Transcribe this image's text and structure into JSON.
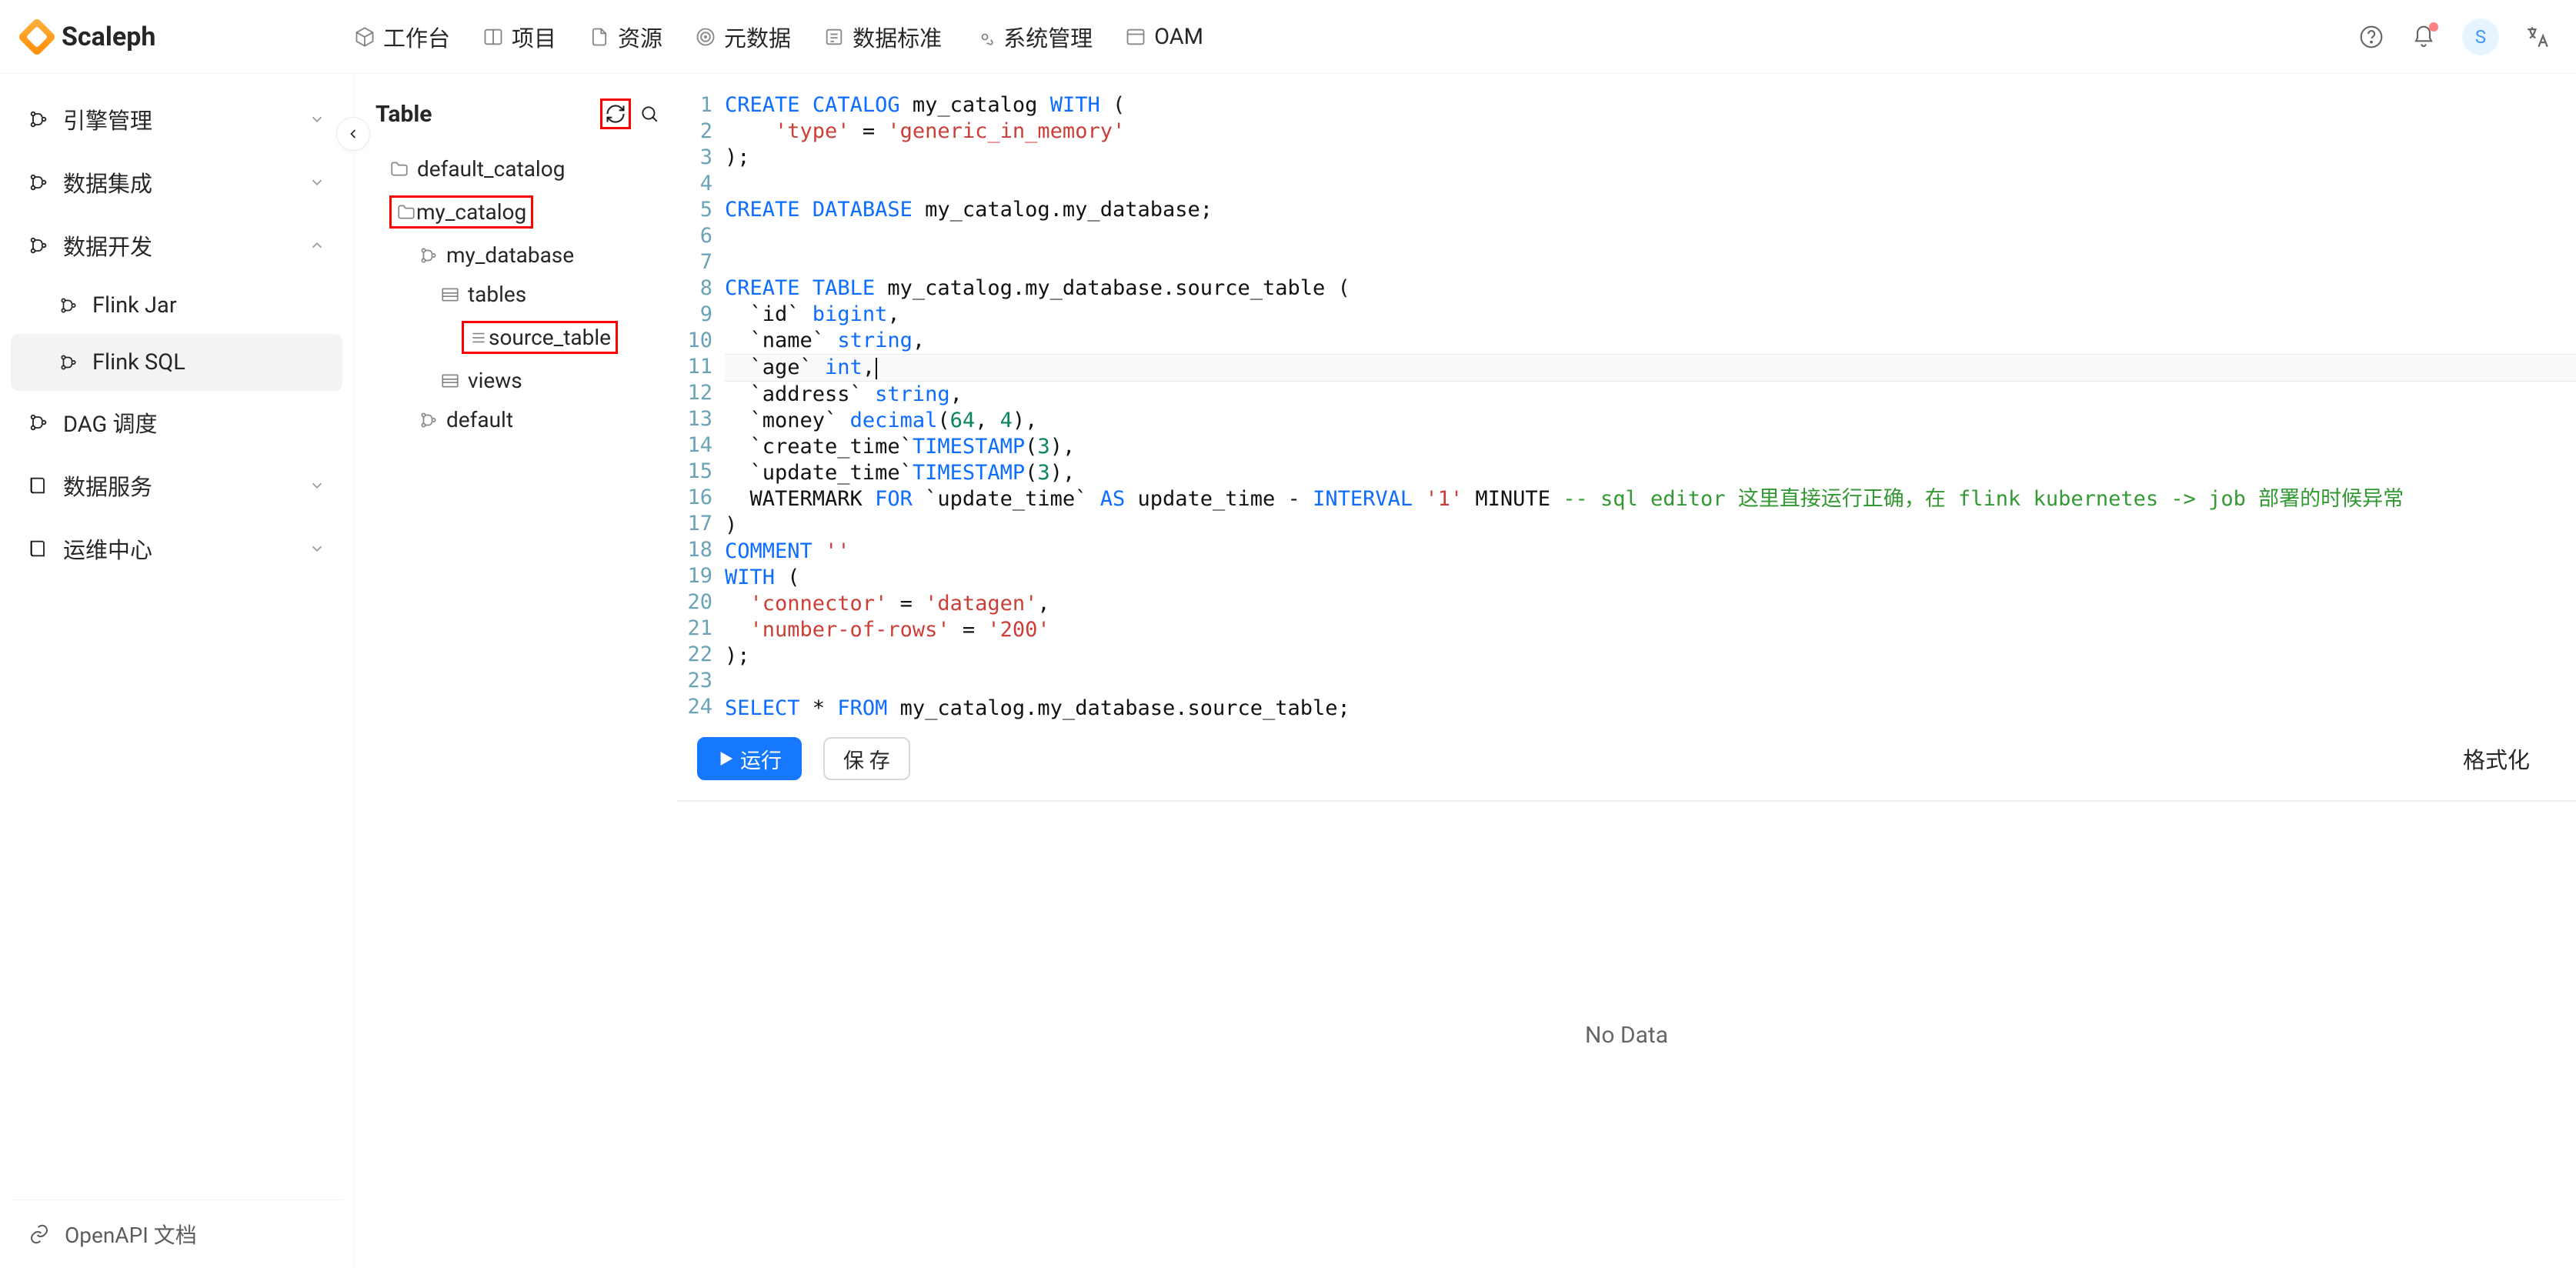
{
  "brand": "Scaleph",
  "topnav": [
    {
      "label": "工作台",
      "icon": "cube"
    },
    {
      "label": "项目",
      "icon": "columns"
    },
    {
      "label": "资源",
      "icon": "file"
    },
    {
      "label": "元数据",
      "icon": "target"
    },
    {
      "label": "数据标准",
      "icon": "list"
    },
    {
      "label": "系统管理",
      "icon": "gear"
    },
    {
      "label": "OAM",
      "icon": "window"
    }
  ],
  "avatar_initial": "S",
  "sidebar": {
    "groups": [
      {
        "label": "引擎管理",
        "expanded": false
      },
      {
        "label": "数据集成",
        "expanded": false
      },
      {
        "label": "数据开发",
        "expanded": true,
        "children": [
          {
            "label": "Flink Jar",
            "active": false
          },
          {
            "label": "Flink SQL",
            "active": true
          }
        ]
      },
      {
        "label": "DAG 调度",
        "leaf": true
      },
      {
        "label": "数据服务",
        "expanded": false
      },
      {
        "label": "运维中心",
        "expanded": false
      }
    ],
    "bottom": "OpenAPI 文档"
  },
  "tablePanel": {
    "title": "Table",
    "tree": [
      {
        "level": 1,
        "icon": "folder",
        "label": "default_catalog"
      },
      {
        "level": 1,
        "icon": "folder",
        "label": "my_catalog",
        "highlight": true
      },
      {
        "level": 2,
        "icon": "branch",
        "label": "my_database"
      },
      {
        "level": 3,
        "icon": "table",
        "label": "tables"
      },
      {
        "level": 4,
        "icon": "rows",
        "label": "source_table",
        "highlight": true
      },
      {
        "level": 3,
        "icon": "table",
        "label": "views"
      },
      {
        "level": 2,
        "icon": "branch",
        "label": "default"
      }
    ]
  },
  "editor": {
    "current_line": 11,
    "lines": [
      [
        {
          "kw": "CREATE"
        },
        {
          "t": " "
        },
        {
          "kw": "CATALOG"
        },
        {
          "t": " my_catalog "
        },
        {
          "kw": "WITH"
        },
        {
          "t": " "
        },
        {
          "ident": "("
        }
      ],
      [
        {
          "t": "    "
        },
        {
          "str": "'type'"
        },
        {
          "t": " = "
        },
        {
          "str": "'generic_in_memory'"
        }
      ],
      [
        {
          "t": ");"
        }
      ],
      [
        {
          "t": ""
        }
      ],
      [
        {
          "kw": "CREATE"
        },
        {
          "t": " "
        },
        {
          "kw": "DATABASE"
        },
        {
          "t": " my_catalog.my_database;"
        }
      ],
      [
        {
          "t": ""
        }
      ],
      [
        {
          "t": ""
        }
      ],
      [
        {
          "kw": "CREATE"
        },
        {
          "t": " "
        },
        {
          "kw": "TABLE"
        },
        {
          "t": " my_catalog.my_database.source_table "
        },
        {
          "ident": "("
        }
      ],
      [
        {
          "t": "  `id` "
        },
        {
          "kw": "bigint"
        },
        {
          "t": ","
        }
      ],
      [
        {
          "t": "  `name` "
        },
        {
          "kw": "string"
        },
        {
          "t": ","
        }
      ],
      [
        {
          "t": "  `age` "
        },
        {
          "kw": "int"
        },
        {
          "t": ","
        }
      ],
      [
        {
          "t": "  `address` "
        },
        {
          "kw": "string"
        },
        {
          "t": ","
        }
      ],
      [
        {
          "t": "  `money` "
        },
        {
          "kw": "decimal"
        },
        {
          "t": "("
        },
        {
          "num": "64"
        },
        {
          "t": ", "
        },
        {
          "num": "4"
        },
        {
          "t": "),"
        }
      ],
      [
        {
          "t": "  `create_time`"
        },
        {
          "kw": "TIMESTAMP"
        },
        {
          "t": "("
        },
        {
          "num": "3"
        },
        {
          "t": "),"
        }
      ],
      [
        {
          "t": "  `update_time`"
        },
        {
          "kw": "TIMESTAMP"
        },
        {
          "t": "("
        },
        {
          "num": "3"
        },
        {
          "t": "),"
        }
      ],
      [
        {
          "t": "  WATERMARK "
        },
        {
          "kw": "FOR"
        },
        {
          "t": " `update_time` "
        },
        {
          "kw": "AS"
        },
        {
          "t": " update_time - "
        },
        {
          "kw": "INTERVAL"
        },
        {
          "t": " "
        },
        {
          "str": "'1'"
        },
        {
          "t": " MINUTE "
        },
        {
          "cmt": "-- sql editor 这里直接运行正确，在 flink kubernetes -> job 部署的时候异常"
        }
      ],
      [
        {
          "ident": ")"
        }
      ],
      [
        {
          "kw": "COMMENT"
        },
        {
          "t": " "
        },
        {
          "str": "''"
        }
      ],
      [
        {
          "kw": "WITH"
        },
        {
          "t": " ("
        }
      ],
      [
        {
          "t": "  "
        },
        {
          "str": "'connector'"
        },
        {
          "t": " = "
        },
        {
          "str": "'datagen'"
        },
        {
          "t": ","
        }
      ],
      [
        {
          "t": "  "
        },
        {
          "str": "'number-of-rows'"
        },
        {
          "t": " = "
        },
        {
          "str": "'200'"
        }
      ],
      [
        {
          "t": ");"
        }
      ],
      [
        {
          "t": ""
        }
      ],
      [
        {
          "kw": "SELECT"
        },
        {
          "t": " * "
        },
        {
          "kw": "FROM"
        },
        {
          "t": " my_catalog.my_database.source_table;"
        }
      ]
    ]
  },
  "actions": {
    "run": "运行",
    "save": "保 存",
    "format": "格式化"
  },
  "resultEmpty": "No Data"
}
